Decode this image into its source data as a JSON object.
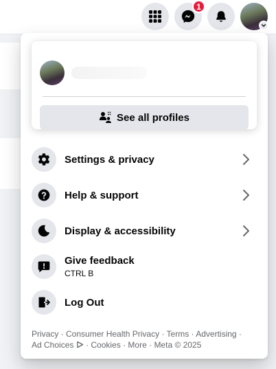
{
  "topbar": {
    "menu_icon": "grid-icon",
    "messenger_icon": "messenger-icon",
    "messenger_badge": "1",
    "notifications_icon": "bell-icon",
    "avatar_chevron_icon": "chevron-down-icon"
  },
  "profile": {
    "name": "",
    "see_all_label": "See all profiles"
  },
  "menu": {
    "items": [
      {
        "label": "Settings & privacy",
        "icon": "gear-icon",
        "has_arrow": true
      },
      {
        "label": "Help & support",
        "icon": "question-icon",
        "has_arrow": true
      },
      {
        "label": "Display & accessibility",
        "icon": "moon-icon",
        "has_arrow": true
      },
      {
        "label": "Give feedback",
        "sub": "CTRL B",
        "icon": "feedback-icon",
        "has_arrow": false
      },
      {
        "label": "Log Out",
        "icon": "logout-icon",
        "has_arrow": false
      }
    ]
  },
  "footer": {
    "privacy": "Privacy",
    "consumer_health": "Consumer Health Privacy",
    "terms": "Terms",
    "advertising": "Advertising",
    "ad_choices": "Ad Choices",
    "cookies": "Cookies",
    "more": "More",
    "copyright": "Meta © 2025",
    "sep": " · "
  },
  "colors": {
    "badge": "#e41e3f",
    "icon_bg": "#e4e6eb",
    "footer_text": "#65676b"
  }
}
